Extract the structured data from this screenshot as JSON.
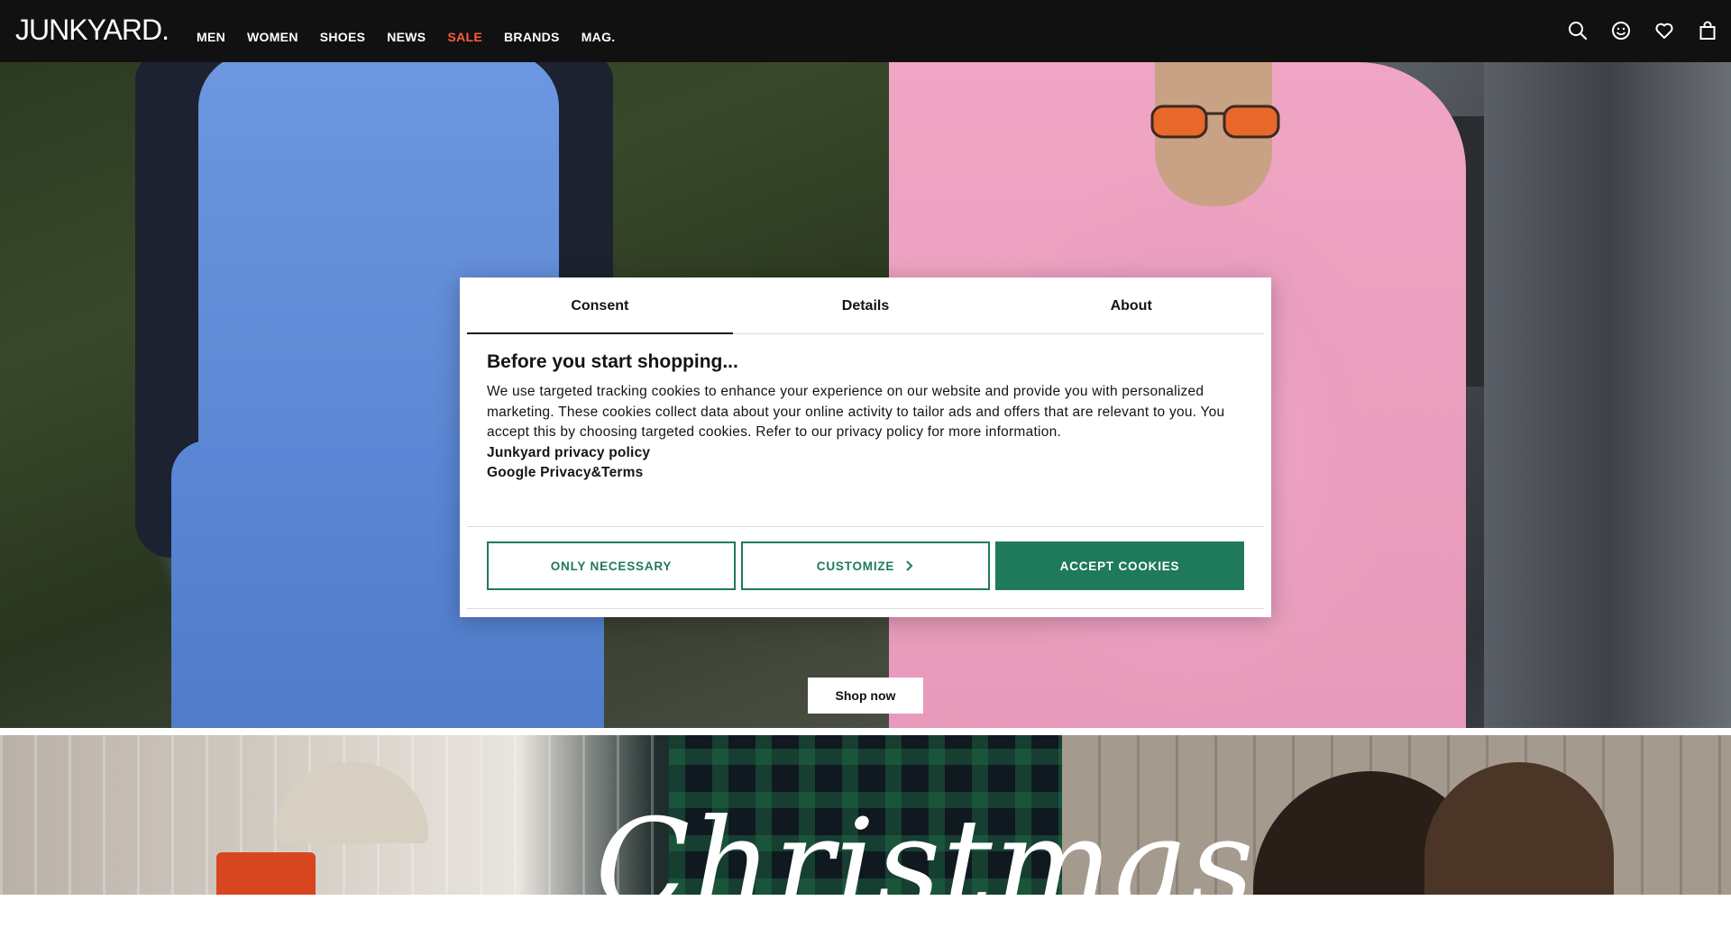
{
  "header": {
    "logo": "JUNKYARD.",
    "nav": [
      {
        "label": "MEN"
      },
      {
        "label": "WOMEN"
      },
      {
        "label": "SHOES"
      },
      {
        "label": "NEWS"
      },
      {
        "label": "SALE"
      },
      {
        "label": "BRANDS"
      },
      {
        "label": "MAG."
      }
    ],
    "icons": [
      "search-icon",
      "account-icon",
      "wishlist-icon",
      "cart-icon"
    ]
  },
  "hero": {
    "shop_now_label": "Shop now"
  },
  "banner2": {
    "title": "Christmas"
  },
  "consent": {
    "tabs": [
      {
        "label": "Consent",
        "active": true
      },
      {
        "label": "Details",
        "active": false
      },
      {
        "label": "About",
        "active": false
      }
    ],
    "title": "Before you start shopping...",
    "body": "We use targeted tracking cookies to enhance your experience on our website and provide you with personalized marketing. These cookies collect data about your online activity to tailor ads and offers that are relevant to you. You accept this by choosing targeted cookies. Refer to our privacy policy for more information.",
    "links": [
      "Junkyard privacy policy",
      "Google Privacy&Terms"
    ],
    "buttons": {
      "only_necessary": "ONLY NECESSARY",
      "customize": "CUSTOMIZE",
      "accept": "ACCEPT COOKIES"
    }
  },
  "colors": {
    "header_bg": "#111111",
    "sale": "#ff5a3c",
    "accent_green": "#1f7a5c"
  }
}
